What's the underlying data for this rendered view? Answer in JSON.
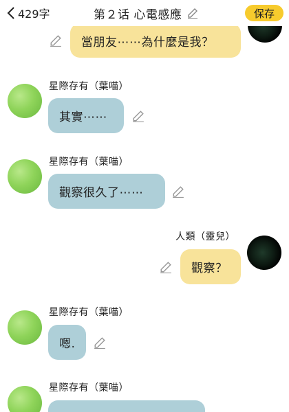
{
  "header": {
    "word_count": "429字",
    "chapter_title": "第２话 心電感應",
    "save_label": "保存"
  },
  "characters": {
    "stellar": "星際存有（葉喵）",
    "human": "人類（靈兒）"
  },
  "messages": [
    {
      "side": "right",
      "text": "當朋友⋯⋯為什麼是我？"
    },
    {
      "side": "left",
      "sender": "星際存有（葉喵）",
      "text": "其實⋯⋯"
    },
    {
      "side": "left",
      "sender": "星際存有（葉喵）",
      "text": "觀察很久了⋯⋯"
    },
    {
      "side": "right",
      "sender": "人類（靈兒）",
      "text": "觀察？"
    },
    {
      "side": "left",
      "sender": "星際存有（葉喵）",
      "text": "嗯."
    },
    {
      "side": "left",
      "sender": "星際存有（葉喵）",
      "text": ""
    }
  ],
  "colors": {
    "save_button": "#f7cb2d",
    "left_bubble": "#aecfd8",
    "right_bubble": "#f8e39a"
  },
  "icons": [
    "chevron-left-icon",
    "pencil-edit-icon"
  ]
}
